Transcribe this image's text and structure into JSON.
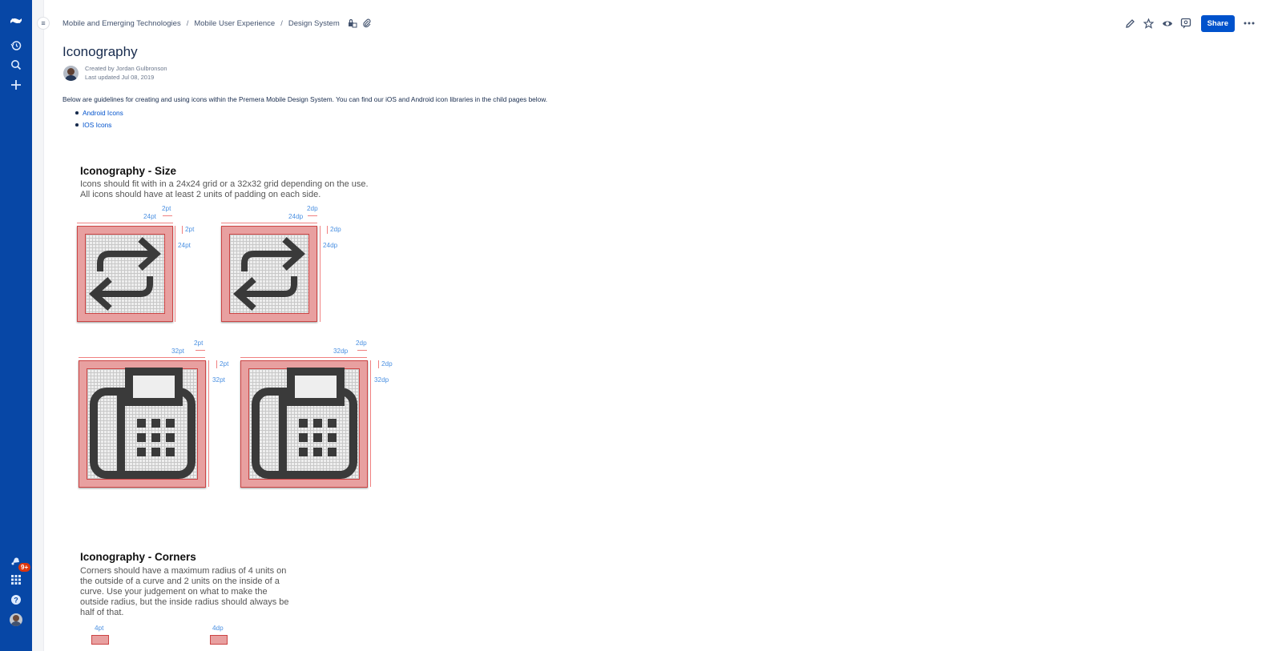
{
  "breadcrumb": [
    "Mobile and Emerging Technologies",
    "Mobile User Experience",
    "Design System"
  ],
  "header": {
    "share_label": "Share"
  },
  "page": {
    "title": "Iconography",
    "created_by": "Created by Jordan Gulbronson",
    "last_updated": "Last updated Jul 08, 2019",
    "intro": "Below are guidelines for creating and using icons within the Premera Mobile Design System. You can find our iOS and Android icon libraries in the child pages below.",
    "links": [
      "Android Icons",
      "IOS Icons"
    ]
  },
  "nav": {
    "notification_badge": "9+"
  },
  "size_section": {
    "title": "Iconography - Size",
    "desc_line1": "Icons should fit with in a 24x24 grid or a 32x32 grid depending on the use.",
    "desc_line2": "All icons should have at least 2 units of padding on each side.",
    "ios24": {
      "width": "24pt",
      "pad_top": "2pt",
      "pad_side": "2pt",
      "height": "24pt"
    },
    "and24": {
      "width": "24dp",
      "pad_top": "2dp",
      "pad_side": "2dp",
      "height": "24dp"
    },
    "ios32": {
      "width": "32pt",
      "pad_top": "2pt",
      "pad_side": "2pt",
      "height": "32pt"
    },
    "and32": {
      "width": "32dp",
      "pad_top": "2dp",
      "pad_side": "2dp",
      "height": "32dp"
    }
  },
  "corners_section": {
    "title": "Iconography - Corners",
    "desc": [
      "Corners should have a maximum radius of 4 units on",
      "the outside of a curve and 2 units on the inside of a",
      "curve. Use your judgement on what to make the",
      "outside radius, but the inside radius should always be",
      "half of that."
    ],
    "ios_label": "4pt",
    "and_label": "4dp"
  },
  "icons": {
    "nav": [
      "confluence-logo-icon",
      "recent-icon",
      "search-icon",
      "create-icon",
      "notifications-icon",
      "app-switcher-icon",
      "help-icon",
      "profile-avatar"
    ],
    "actions": [
      "edit-icon",
      "star-icon",
      "watch-icon",
      "analytics-icon",
      "more-icon"
    ]
  }
}
